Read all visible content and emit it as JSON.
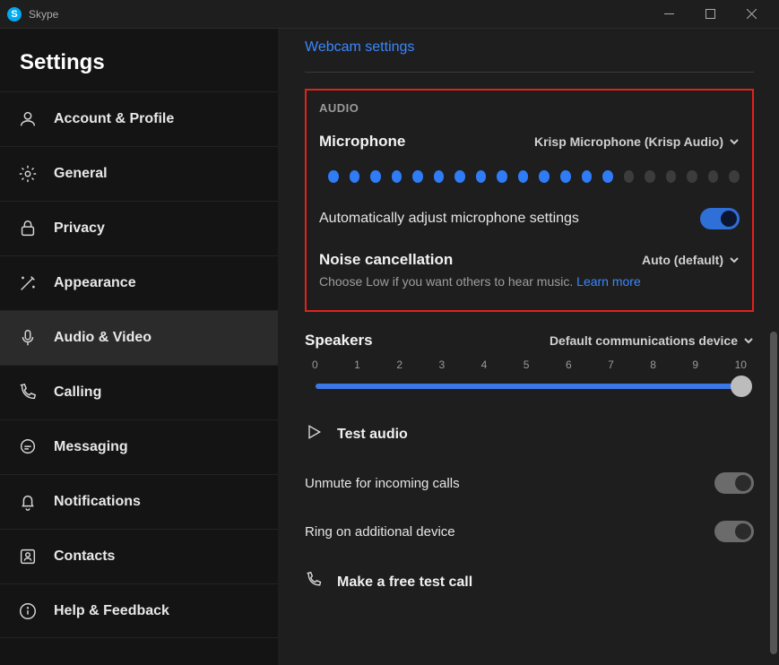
{
  "window": {
    "title": "Skype"
  },
  "sidebar": {
    "heading": "Settings",
    "items": [
      {
        "label": "Account & Profile"
      },
      {
        "label": "General"
      },
      {
        "label": "Privacy"
      },
      {
        "label": "Appearance"
      },
      {
        "label": "Audio & Video"
      },
      {
        "label": "Calling"
      },
      {
        "label": "Messaging"
      },
      {
        "label": "Notifications"
      },
      {
        "label": "Contacts"
      },
      {
        "label": "Help & Feedback"
      }
    ]
  },
  "content": {
    "webcam_link": "Webcam settings",
    "audio_section": "AUDIO",
    "microphone": {
      "label": "Microphone",
      "device": "Krisp Microphone (Krisp Audio)",
      "level_active": 14,
      "level_total": 20
    },
    "auto_adjust": {
      "label": "Automatically adjust microphone settings",
      "on": true
    },
    "noise": {
      "label": "Noise cancellation",
      "value": "Auto (default)",
      "hint": "Choose Low if you want others to hear music.",
      "learn_more": "Learn more"
    },
    "speakers": {
      "label": "Speakers",
      "device": "Default communications device",
      "ticks": [
        "0",
        "1",
        "2",
        "3",
        "4",
        "5",
        "6",
        "7",
        "8",
        "9",
        "10"
      ],
      "value": 10
    },
    "test_audio": "Test audio",
    "unmute": {
      "label": "Unmute for incoming calls",
      "on": false
    },
    "ring": {
      "label": "Ring on additional device",
      "on": false
    },
    "test_call": "Make a free test call"
  }
}
